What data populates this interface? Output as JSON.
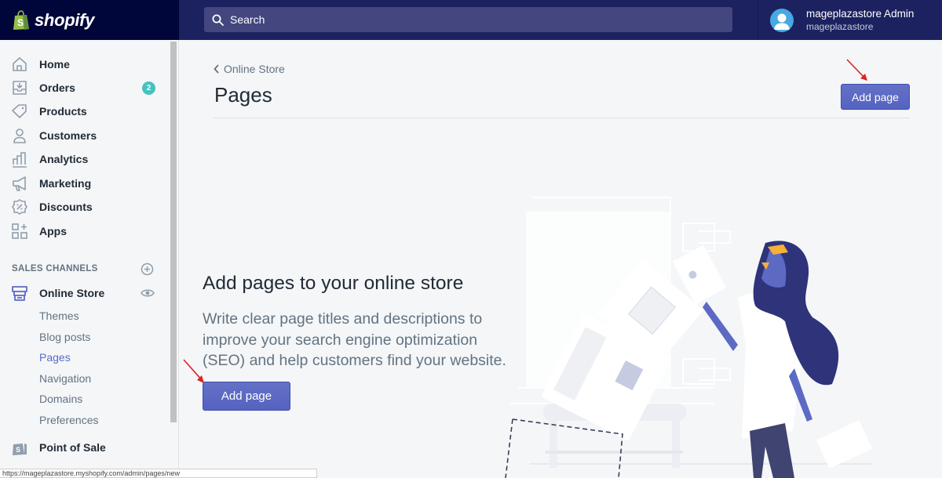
{
  "topbar": {
    "logo_text": "shopify",
    "search_placeholder": "Search",
    "user_name": "mageplazastore Admin",
    "store_name": "mageplazastore"
  },
  "sidebar": {
    "items": [
      {
        "label": "Home",
        "icon": "home-icon"
      },
      {
        "label": "Orders",
        "icon": "orders-icon",
        "badge": "2"
      },
      {
        "label": "Products",
        "icon": "tag-icon"
      },
      {
        "label": "Customers",
        "icon": "person-icon"
      },
      {
        "label": "Analytics",
        "icon": "bar-chart-icon"
      },
      {
        "label": "Marketing",
        "icon": "megaphone-icon"
      },
      {
        "label": "Discounts",
        "icon": "discount-icon"
      },
      {
        "label": "Apps",
        "icon": "apps-icon"
      }
    ],
    "sales_channels_title": "SALES CHANNELS",
    "online_store": {
      "label": "Online Store",
      "sub_items": [
        "Themes",
        "Blog posts",
        "Pages",
        "Navigation",
        "Domains",
        "Preferences"
      ],
      "active": "Pages"
    },
    "point_of_sale": "Point of Sale"
  },
  "main": {
    "breadcrumb": "Online Store",
    "title": "Pages",
    "add_page_label": "Add page",
    "empty_state": {
      "heading": "Add pages to your online store",
      "description": "Write clear page titles and descriptions to improve your search engine optimization (SEO) and help customers find your website.",
      "button_label": "Add page"
    }
  },
  "status_url": "https://mageplazastore.myshopify.com/admin/pages/new",
  "colors": {
    "topbar": "#1c2260",
    "logo_bg": "#000639",
    "primary": "#5c6ac4",
    "badge": "#47c1bf",
    "annotation_arrow": "#e02020"
  }
}
